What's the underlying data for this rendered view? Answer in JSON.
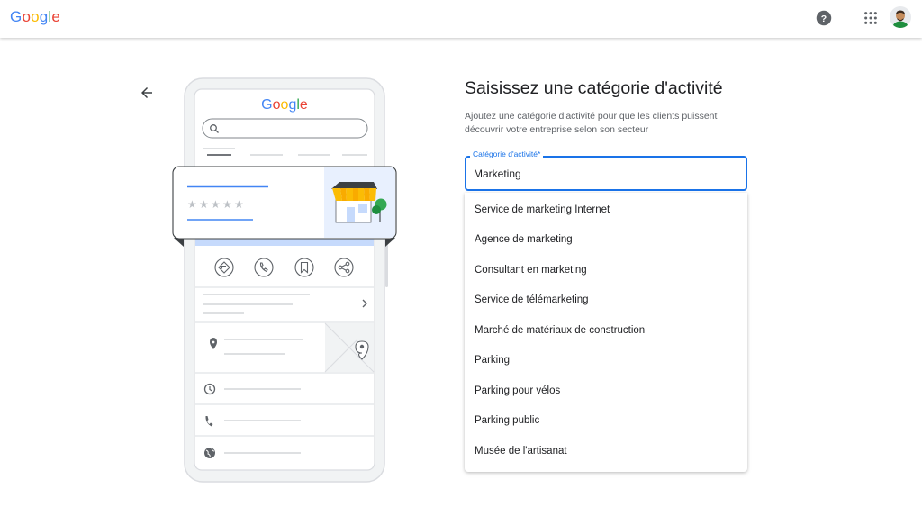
{
  "header": {
    "logo_letters": [
      {
        "char": "G",
        "color": "#4285F4"
      },
      {
        "char": "o",
        "color": "#EA4335"
      },
      {
        "char": "o",
        "color": "#FBBC05"
      },
      {
        "char": "g",
        "color": "#4285F4"
      },
      {
        "char": "l",
        "color": "#34A853"
      },
      {
        "char": "e",
        "color": "#EA4335"
      }
    ],
    "help_icon": "help-circle-icon",
    "apps_icon": "apps-grid-icon",
    "avatar_icon": "account-avatar-icon"
  },
  "illustration": {
    "logo_text": "Google"
  },
  "form": {
    "title": "Saisissez une catégorie d'activité",
    "description": "Ajoutez une catégorie d'activité pour que les clients puissent découvrir votre entreprise selon son secteur",
    "field_label": "Catégorie d'activité*",
    "field_value": "Marketing"
  },
  "suggestions": [
    "Service de marketing Internet",
    "Agence de marketing",
    "Consultant en marketing",
    "Service de télémarketing",
    "Marché de matériaux de construction",
    "Parking",
    "Parking pour vélos",
    "Parking public",
    "Musée de l'artisanat"
  ],
  "colors": {
    "accent": "#1a73e8",
    "google_blue": "#4285F4",
    "google_red": "#EA4335",
    "google_yellow": "#FBBC05",
    "google_green": "#34A853"
  }
}
